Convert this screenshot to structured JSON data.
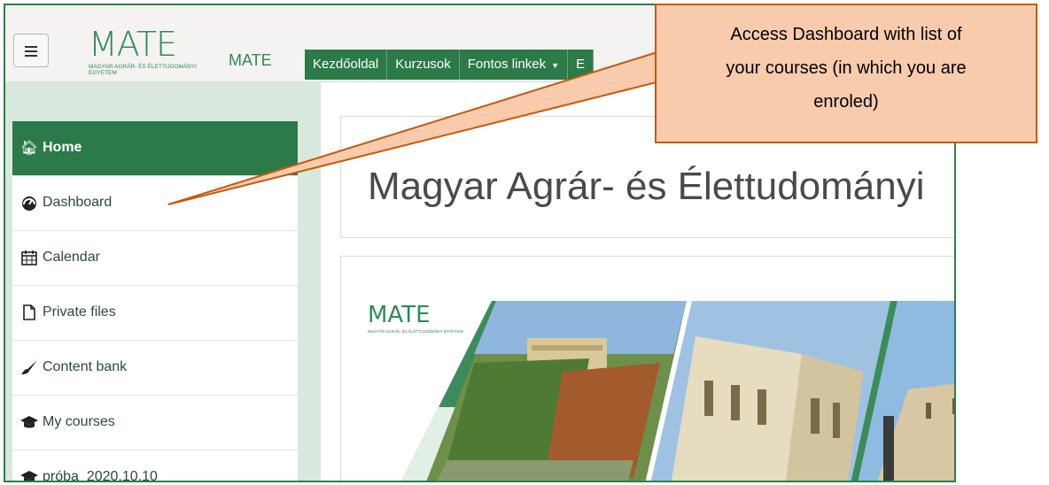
{
  "navbar": {
    "logo_mark": "MATE",
    "logo_subtitle": "MAGYAR AGRÁR- ÉS ÉLETTUDOMÁNYI EGYETEM",
    "site_short_name": "MATE",
    "links": [
      {
        "label": "Kezdőoldal"
      },
      {
        "label": "Kurzusok"
      },
      {
        "label": "Fontos linkek",
        "has_dropdown": true
      },
      {
        "label": "E"
      }
    ]
  },
  "sidebar": {
    "items": [
      {
        "label": "Home",
        "icon": "home-icon",
        "active": true
      },
      {
        "label": "Dashboard",
        "icon": "dashboard-icon",
        "active": false
      },
      {
        "label": "Calendar",
        "icon": "calendar-icon",
        "active": false
      },
      {
        "label": "Private files",
        "icon": "file-icon",
        "active": false
      },
      {
        "label": "Content bank",
        "icon": "brush-icon",
        "active": false
      },
      {
        "label": "My courses",
        "icon": "graduation-cap-icon",
        "active": false
      },
      {
        "label": "próba_2020.10.10",
        "icon": "graduation-cap-icon",
        "active": false
      }
    ]
  },
  "main": {
    "site_title": "Magyar Agrár- és Élettudományi",
    "hero": {
      "logo_mark": "MATE",
      "logo_subtitle": "MAGYAR AGRÁR- ÉS ÉLETTUDOMÁNYI EGYETEM"
    }
  },
  "callout": {
    "lines": [
      "Access Dashboard with list of",
      "your courses (in which you are",
      "enroled)"
    ]
  },
  "colors": {
    "brand_green": "#2b7a47",
    "sidebar_bg": "#d9e8dc",
    "callout_fill": "#f8cbad",
    "callout_border": "#c55a11"
  }
}
